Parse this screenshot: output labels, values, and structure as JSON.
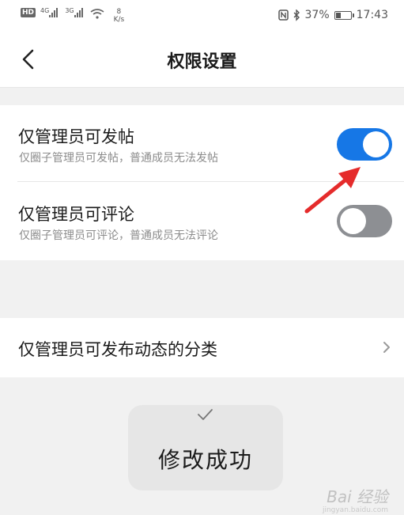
{
  "status_bar": {
    "hd_label": "HD",
    "net1": "4G",
    "net2": "3G",
    "speed_value": "8",
    "speed_unit": "K/s",
    "battery_percent": "37%",
    "battery_level": 0.37,
    "time": "17:43",
    "icons": [
      "nfc-icon",
      "bluetooth-icon",
      "wifi-icon",
      "signal-icon",
      "battery-icon"
    ]
  },
  "header": {
    "title": "权限设置",
    "back_icon": "chevron-left-icon"
  },
  "settings": [
    {
      "title": "仅管理员可发帖",
      "description": "仅圈子管理员可发帖，普通成员无法发帖",
      "enabled": true
    },
    {
      "title": "仅管理员可评论",
      "description": "仅圈子管理员可评论，普通成员无法评论",
      "enabled": false
    }
  ],
  "nav_item": {
    "label": "仅管理员可发布动态的分类",
    "icon": "chevron-right-icon"
  },
  "toast": {
    "message": "修改成功",
    "icon": "check-icon"
  },
  "watermark": {
    "text": "Bai 经验",
    "subtext": "jingyan.baidu.com"
  },
  "colors": {
    "accent": "#1677e6",
    "toggle_off": "#8d8f93",
    "annotation": "#e52b2b",
    "background": "#f1f1f1"
  }
}
